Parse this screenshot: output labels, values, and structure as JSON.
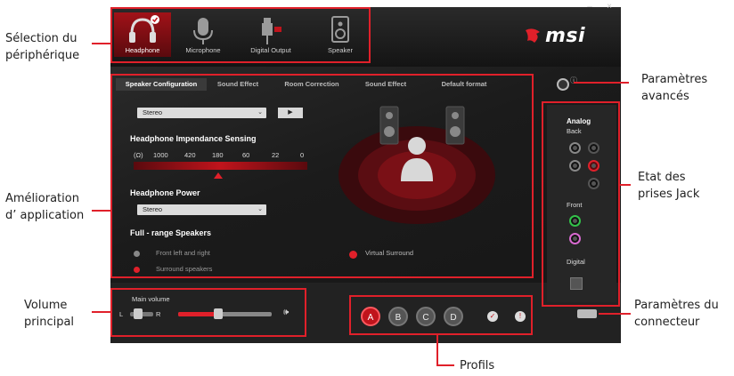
{
  "devices": [
    {
      "label": "Headphone",
      "icon": "headphone-icon",
      "active": true
    },
    {
      "label": "Microphone",
      "icon": "microphone-icon",
      "active": false
    },
    {
      "label": "Digital Output",
      "icon": "digital-output-icon",
      "active": false
    },
    {
      "label": "Speaker",
      "icon": "speaker-icon",
      "active": false
    }
  ],
  "window": {
    "minimize": "–",
    "close": "×"
  },
  "brand": {
    "name": "msi"
  },
  "tabs": [
    {
      "label": "Speaker Configuration",
      "active": true
    },
    {
      "label": "Sound Effect",
      "active": false
    },
    {
      "label": "Room Correction",
      "active": false
    },
    {
      "label": "Sound Effect",
      "active": false
    },
    {
      "label": "Default format",
      "active": false
    }
  ],
  "speaker_config": {
    "mode_select": "Stereo",
    "play_label": "▶",
    "impedance_heading": "Headphone Impendance Sensing",
    "impedance_unit": "(Ω)",
    "impedance_values": [
      "1000",
      "420",
      "180",
      "60",
      "22",
      "0"
    ],
    "impedance_selected_index": 2,
    "power_heading": "Headphone Power",
    "power_select": "Stereo",
    "fullrange_heading": "Full - range Speakers",
    "option_front": "Front left and right",
    "option_surround": "Surround speakers",
    "option_virtual": "Virtual Surround"
  },
  "jacks": {
    "heading": "Analog",
    "back": "Back",
    "front": "Front",
    "digital": "Digital"
  },
  "volume": {
    "title": "Main volume",
    "left": "L",
    "right": "R",
    "speaker_icon": "speaker-volume-icon"
  },
  "profiles": [
    "A",
    "B",
    "C",
    "D"
  ],
  "callouts": {
    "device_selection": "Sélection du\npériphérique",
    "app_enhancement": "Amélioration\nd’ application",
    "main_volume": "Volume\nprincipal",
    "advanced_settings": "Paramètres\navancés",
    "jack_status": "Etat des\nprises Jack",
    "connector_settings": "Paramètres du\nconnecteur",
    "profiles": "Profils"
  },
  "colors": {
    "accent": "#e0202a",
    "active_red": "#c0141c"
  }
}
